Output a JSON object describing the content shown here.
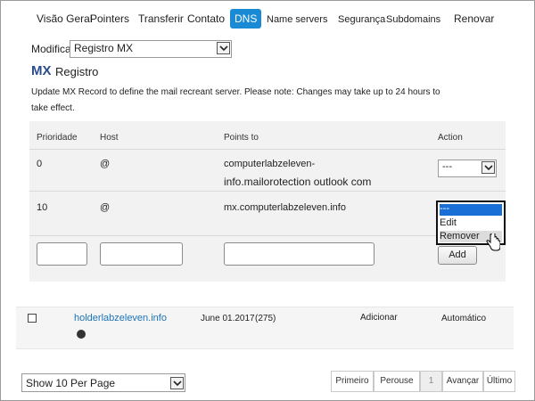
{
  "tabs": [
    {
      "id": "overview",
      "label": "Visão Geral"
    },
    {
      "id": "pointers",
      "label": "Pointers"
    },
    {
      "id": "transfer",
      "label": "Transferir"
    },
    {
      "id": "contact",
      "label": "Contato"
    },
    {
      "id": "dns",
      "label": "DNS",
      "active": true
    },
    {
      "id": "nameservers",
      "label": "Name servers"
    },
    {
      "id": "security",
      "label": "Segurança"
    },
    {
      "id": "subdomains",
      "label": "Subdomains"
    },
    {
      "id": "renew",
      "label": "Renovar"
    }
  ],
  "modify": {
    "label": "Modificar",
    "selected": "Registro MX"
  },
  "record": {
    "badge": "MX",
    "title": "Registro"
  },
  "instructions": {
    "line1": "Update MX Record to define the mail recreant server. Please note: Changes may take up to 24 hours to",
    "line2": "take effect."
  },
  "table": {
    "headers": {
      "priority": "Prioridade",
      "host": "Host",
      "points_to": "Points to",
      "action": "Action"
    },
    "rows": [
      {
        "priority": "0",
        "host": "@",
        "points_to_line1": "computerlabzeleven-",
        "points_to_line2": "info.mailorotection outlook com",
        "action_value": "---"
      },
      {
        "priority": "10",
        "host": "@",
        "points_to": "mx.computerlabzeleven.info",
        "action_value": "---"
      }
    ],
    "add_label": "Add"
  },
  "action_menu": {
    "items": [
      "---",
      "Edit",
      "Remover"
    ],
    "highlighted": 0,
    "hovered": 2
  },
  "domain_row": {
    "name": "holderlabzeleven.info",
    "date": "June 01.2017",
    "count": "(275)",
    "action": "Adicionar",
    "renewal": "Automático"
  },
  "footer": {
    "per_page": "Show 10 Per Page",
    "pager": {
      "first": "Primeiro",
      "prev": "Perouse",
      "page": "1",
      "next": "Avançar",
      "last": "Último"
    }
  }
}
